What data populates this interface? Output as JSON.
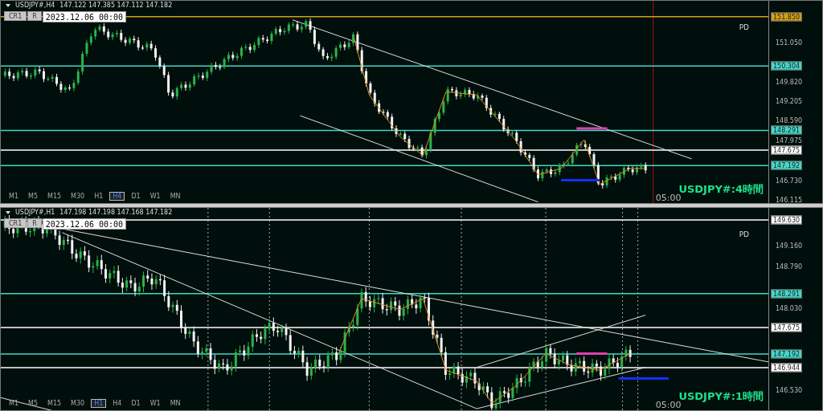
{
  "panels": [
    {
      "symbol": "USDJPY#,H4",
      "quote": "147.122 147.385 147.112 147.182",
      "buttons": [
        "CR1",
        "R"
      ],
      "date": "2023.12.06 00:00",
      "corner_label": "PD",
      "title": "USDJPY#:4時間",
      "time_label": "05:00",
      "timeframes": [
        {
          "label": "M1",
          "selected": false
        },
        {
          "label": "M5",
          "selected": false
        },
        {
          "label": "M15",
          "selected": false
        },
        {
          "label": "M30",
          "selected": false
        },
        {
          "label": "H1",
          "selected": false
        },
        {
          "label": "H4",
          "selected": true
        },
        {
          "label": "D1",
          "selected": false
        },
        {
          "label": "W1",
          "selected": false
        },
        {
          "label": "MN",
          "selected": false
        }
      ],
      "axis_ticks": [
        "151.050",
        "149.820",
        "149.205",
        "148.590",
        "147.975",
        "146.730",
        "146.115"
      ],
      "price_tags": [
        {
          "label": "151.850",
          "color": "#d4a017"
        },
        {
          "label": "150.304",
          "color": "#40d8c8"
        },
        {
          "label": "148.291",
          "color": "#40d8c8"
        },
        {
          "label": "147.675",
          "color": "#ffffff"
        },
        {
          "label": "147.192",
          "color": "#40d8c8"
        }
      ]
    },
    {
      "symbol": "USDJPY#,H1",
      "quote": "147.198 147.198 147.168 147.182",
      "buttons": [
        "CR1",
        "R"
      ],
      "date": "2023.12.06 00:00",
      "corner_label": "PD",
      "title": "USDJPY#:1時間",
      "time_label": "05:00",
      "timeframes": [
        {
          "label": "M1",
          "selected": false
        },
        {
          "label": "M5",
          "selected": false
        },
        {
          "label": "M15",
          "selected": false
        },
        {
          "label": "M30",
          "selected": false
        },
        {
          "label": "H1",
          "selected": true
        },
        {
          "label": "H4",
          "selected": false
        },
        {
          "label": "D1",
          "selected": false
        },
        {
          "label": "W1",
          "selected": false
        },
        {
          "label": "MN",
          "selected": false
        }
      ],
      "axis_ticks": [
        "149.160",
        "148.790",
        "148.030",
        "146.530"
      ],
      "price_tags": [
        {
          "label": "149.630",
          "color": "#ffffff"
        },
        {
          "label": "148.291",
          "color": "#40d8c8"
        },
        {
          "label": "147.675",
          "color": "#ffffff"
        },
        {
          "label": "147.192",
          "color": "#40d8c8"
        },
        {
          "label": "146.944",
          "color": "#ffffff"
        }
      ]
    }
  ]
}
